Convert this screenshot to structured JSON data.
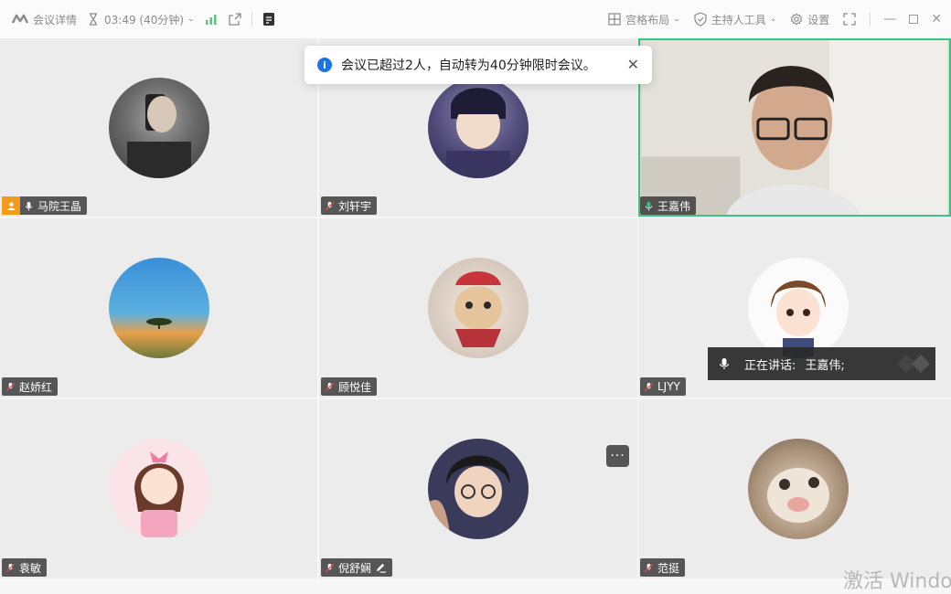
{
  "topbar": {
    "meeting_details": "会议详情",
    "timer": "03:49 (40分钟)",
    "layout": "宫格布局",
    "host_tools": "主持人工具",
    "settings": "设置"
  },
  "toast": {
    "message": "会议已超过2人，自动转为40分钟限时会议。"
  },
  "participants": [
    {
      "name": "马院王晶",
      "host": true,
      "mic": "on"
    },
    {
      "name": "刘轩宇",
      "host": false,
      "mic": "muted"
    },
    {
      "name": "王嘉伟",
      "host": false,
      "mic": "active",
      "video": true
    },
    {
      "name": "赵娇红",
      "host": false,
      "mic": "muted"
    },
    {
      "name": "顾悦佳",
      "host": false,
      "mic": "muted"
    },
    {
      "name": "LJYY",
      "host": false,
      "mic": "muted"
    },
    {
      "name": "袁敏",
      "host": false,
      "mic": "muted"
    },
    {
      "name": "倪舒娴",
      "host": false,
      "mic": "muted",
      "annotating": true
    },
    {
      "name": "范挺",
      "host": false,
      "mic": "muted"
    }
  ],
  "speaking": {
    "label": "正在讲话:",
    "names": "王嘉伟;"
  },
  "watermark": "激活 Windows",
  "colors": {
    "accent": "#3cc47c",
    "host_badge": "#f29a1c",
    "info": "#1a73e8"
  }
}
